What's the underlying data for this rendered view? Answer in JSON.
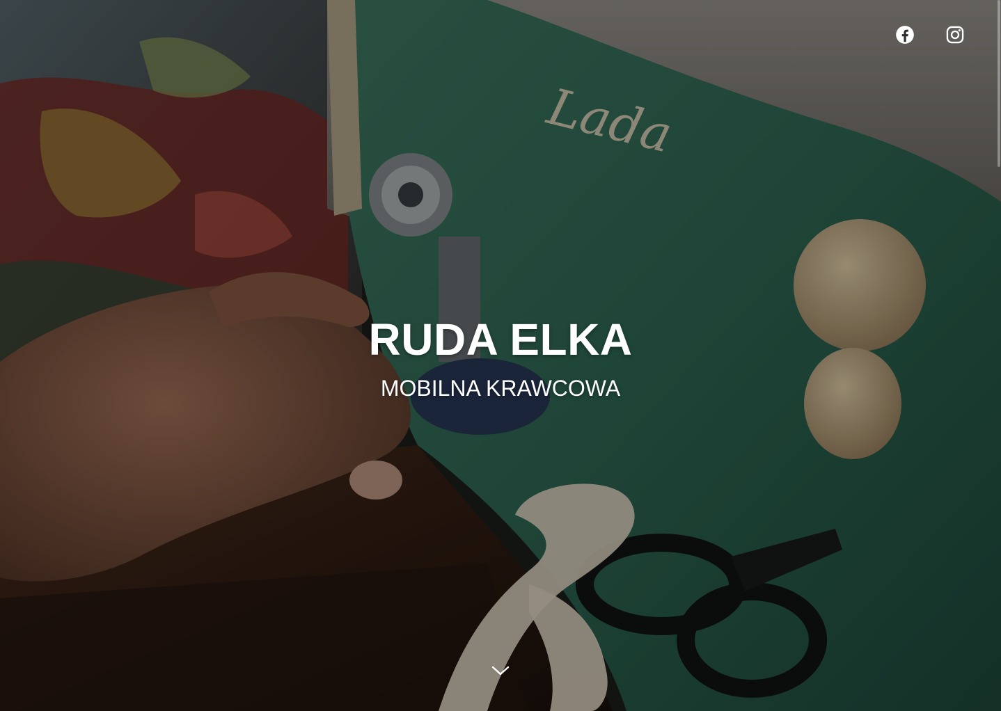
{
  "hero": {
    "title": "RUDA ELKA",
    "subtitle": "MOBILNA KRAWCOWA"
  },
  "social": {
    "facebook_icon": "facebook-icon",
    "instagram_icon": "instagram-icon"
  },
  "scroll": {
    "icon": "chevron-down-icon"
  },
  "colors": {
    "text": "#ffffff",
    "machine_green": "#4f8a6f",
    "table_wood": "#3a2418",
    "overlay": "rgba(0,0,0,0.35)"
  }
}
